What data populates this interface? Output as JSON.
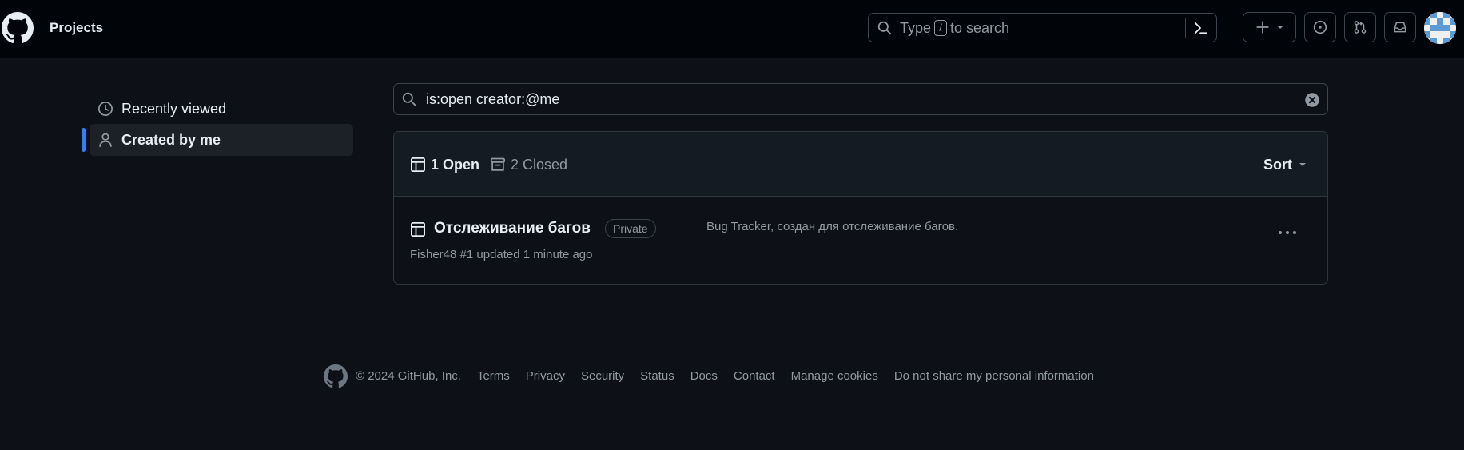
{
  "header": {
    "title": "Projects",
    "search_prefix": "Type",
    "search_key": "/",
    "search_suffix": "to search"
  },
  "sidebar": {
    "items": [
      {
        "label": "Recently viewed",
        "icon": "clock-icon",
        "selected": false
      },
      {
        "label": "Created by me",
        "icon": "person-icon",
        "selected": true
      }
    ]
  },
  "filter": {
    "value": "is:open creator:@me"
  },
  "projects": {
    "open_label": "1 Open",
    "closed_label": "2 Closed",
    "sort_label": "Sort",
    "items": [
      {
        "title": "Отслеживание багов",
        "visibility": "Private",
        "meta": "Fisher48 #1 updated 1 minute ago",
        "description": "Bug Tracker, создан для отслеживание багов."
      }
    ]
  },
  "footer": {
    "copyright": "© 2024 GitHub, Inc.",
    "links": [
      "Terms",
      "Privacy",
      "Security",
      "Status",
      "Docs",
      "Contact",
      "Manage cookies",
      "Do not share my personal information"
    ]
  },
  "colors": {
    "background": "#0d1117",
    "header_bg": "#010409",
    "accent": "#2f81f7",
    "muted_text": "#9198a1"
  }
}
